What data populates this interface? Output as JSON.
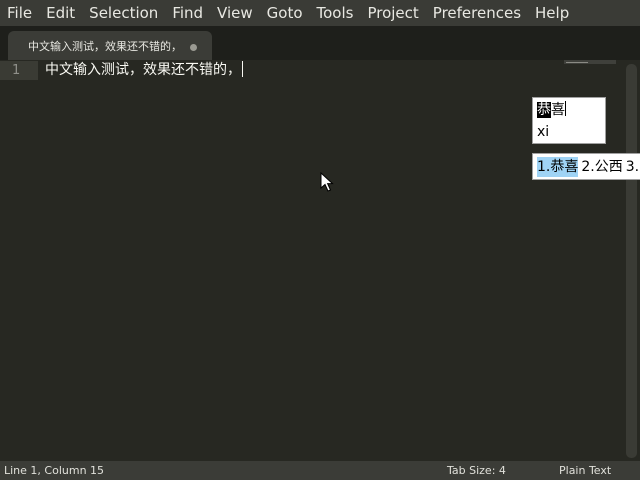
{
  "menubar": {
    "items": [
      "File",
      "Edit",
      "Selection",
      "Find",
      "View",
      "Goto",
      "Tools",
      "Project",
      "Preferences",
      "Help"
    ]
  },
  "tab": {
    "title": "中文输入测试，效果还不错的，",
    "unsaved_indicator": "dot-icon"
  },
  "editor": {
    "line_numbers": [
      "1"
    ],
    "lines": [
      "中文输入测试，效果还不错的，"
    ]
  },
  "ime": {
    "preedit_selected": "恭",
    "preedit_rest": "喜",
    "pinyin": "xi",
    "candidates": [
      "1.恭喜",
      "2.公西",
      "3."
    ]
  },
  "statusbar": {
    "position": "Line 1, Column 15",
    "tab_size": "Tab Size: 4",
    "syntax": "Plain Text"
  },
  "colors": {
    "background": "#272822",
    "menubar": "#3a3b36",
    "candidate_highlight": "#9fd3f5"
  }
}
